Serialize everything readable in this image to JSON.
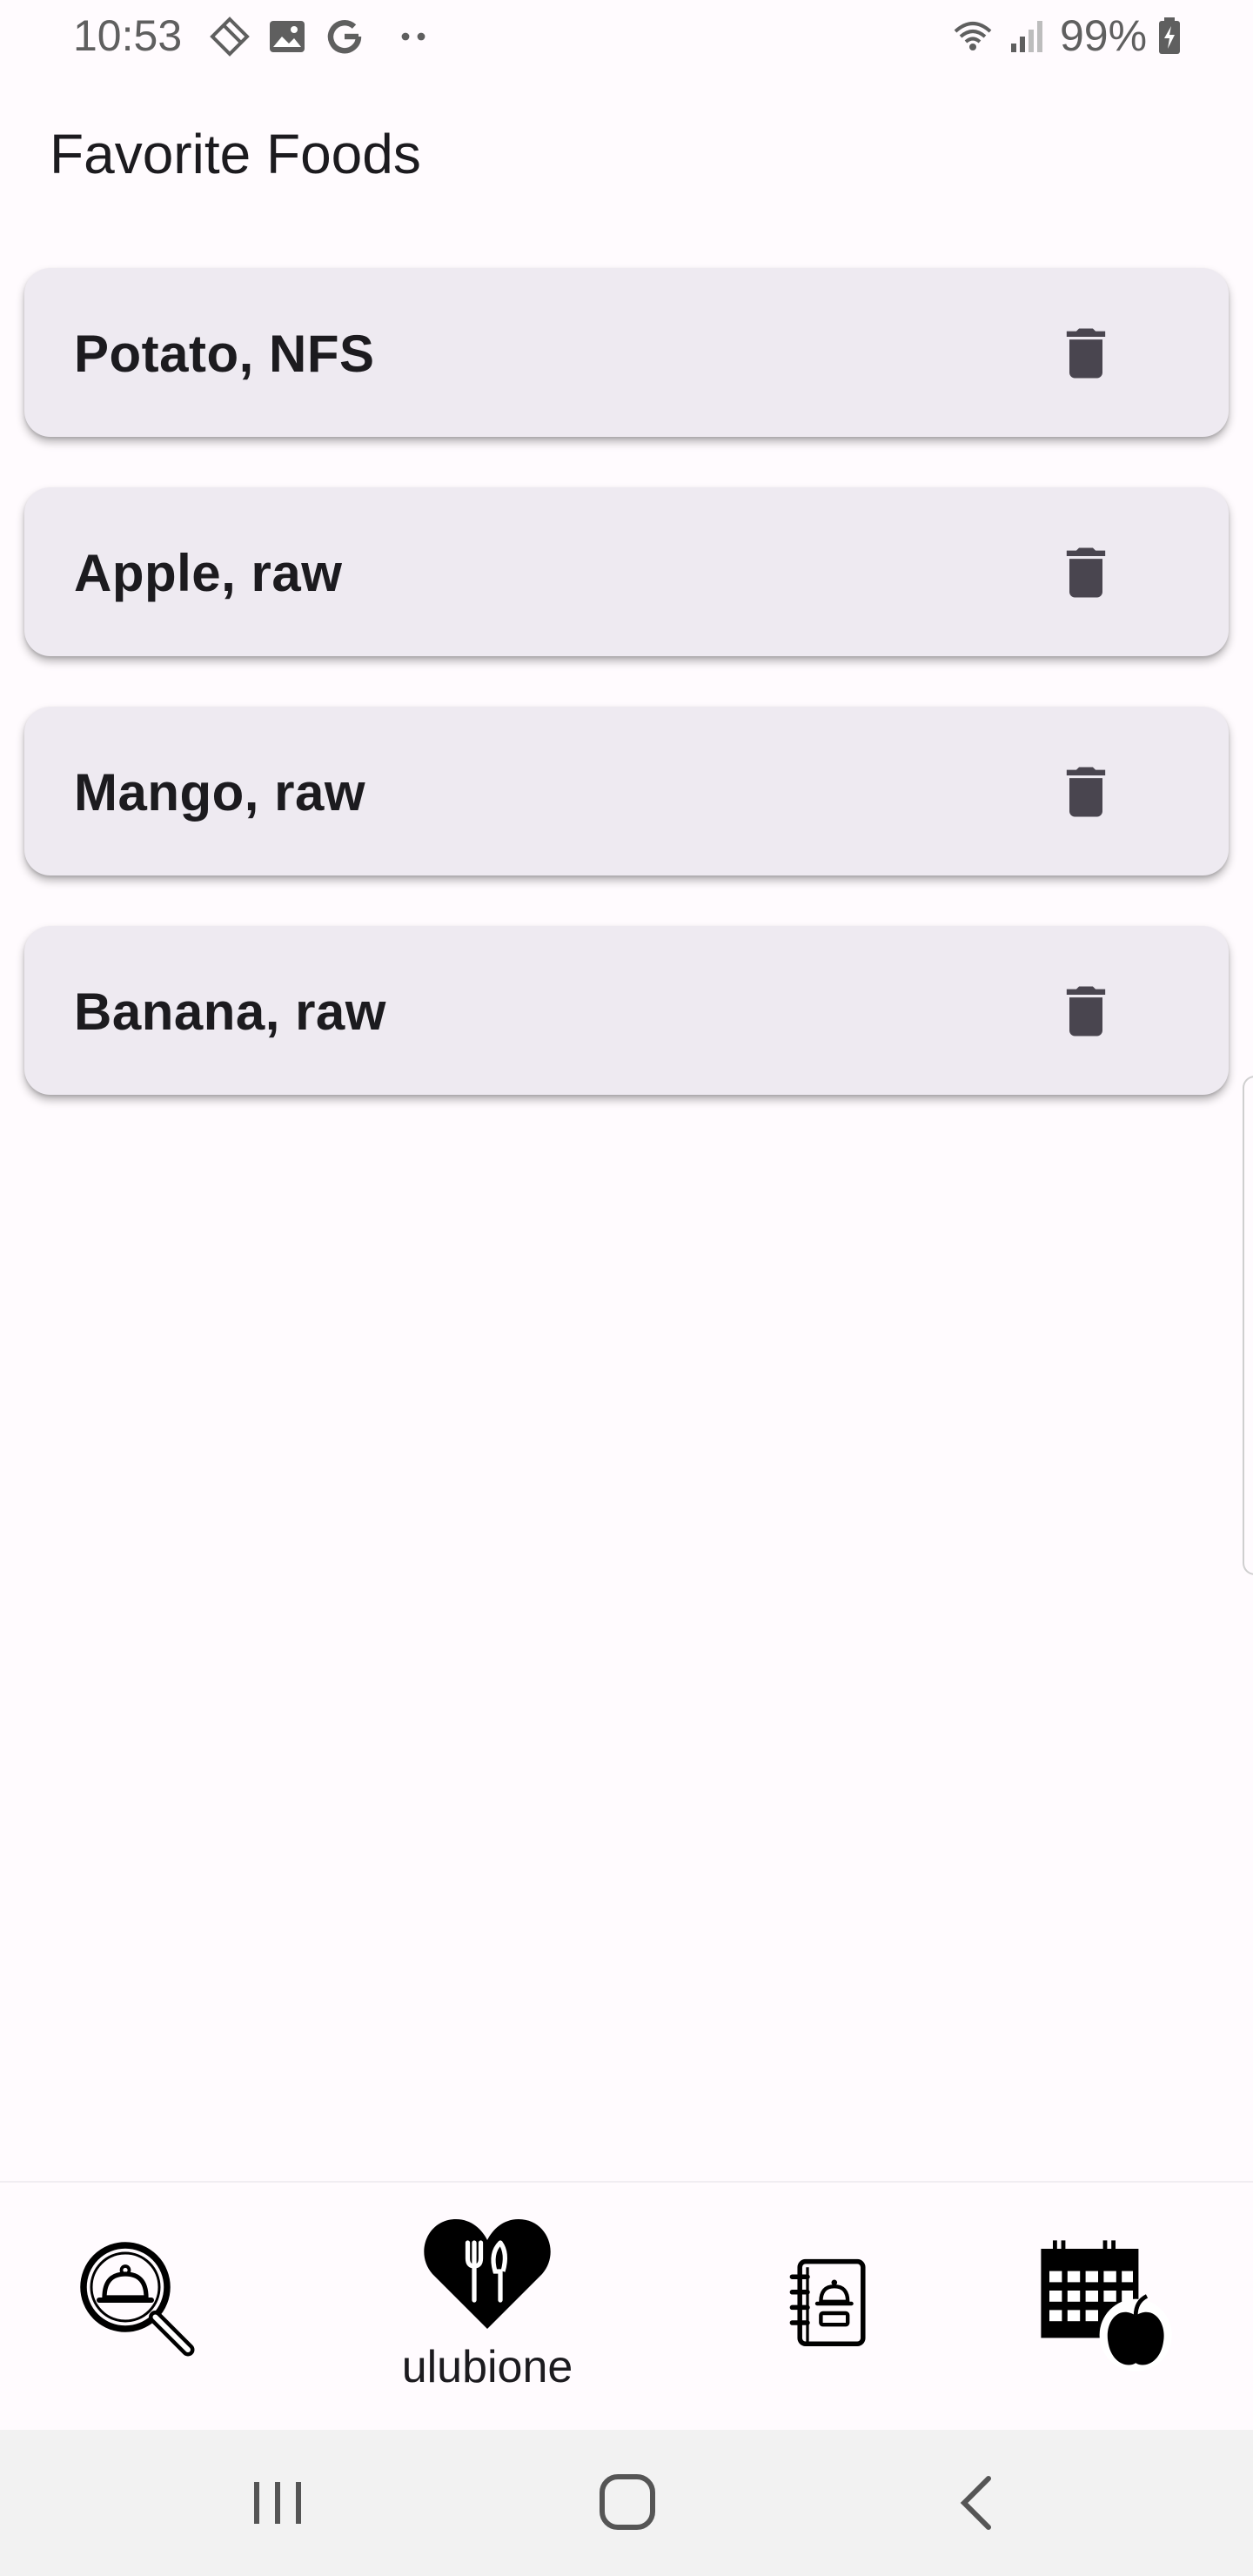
{
  "status_bar": {
    "time": "10:53",
    "battery": "99%",
    "left_icons": [
      "rotation-lock-icon",
      "gallery-icon",
      "google-icon",
      "more-dots-icon"
    ],
    "right_icons": [
      "wifi-icon",
      "signal-icon",
      "battery-charging-icon"
    ]
  },
  "page": {
    "title": "Favorite Foods"
  },
  "foods": [
    {
      "name": "Potato, NFS"
    },
    {
      "name": "Apple, raw"
    },
    {
      "name": "Mango, raw"
    },
    {
      "name": "Banana, raw"
    }
  ],
  "bottom_nav": {
    "items": [
      {
        "icon": "food-search-icon",
        "label": ""
      },
      {
        "icon": "heart-fork-knife-icon",
        "label": "ulubione",
        "active": true
      },
      {
        "icon": "recipe-book-icon",
        "label": ""
      },
      {
        "icon": "calendar-apple-icon",
        "label": ""
      }
    ]
  },
  "colors": {
    "background": "#fffbfe",
    "card": "#eeeaf1",
    "icon": "#49454f",
    "text": "#1c1b1f"
  }
}
